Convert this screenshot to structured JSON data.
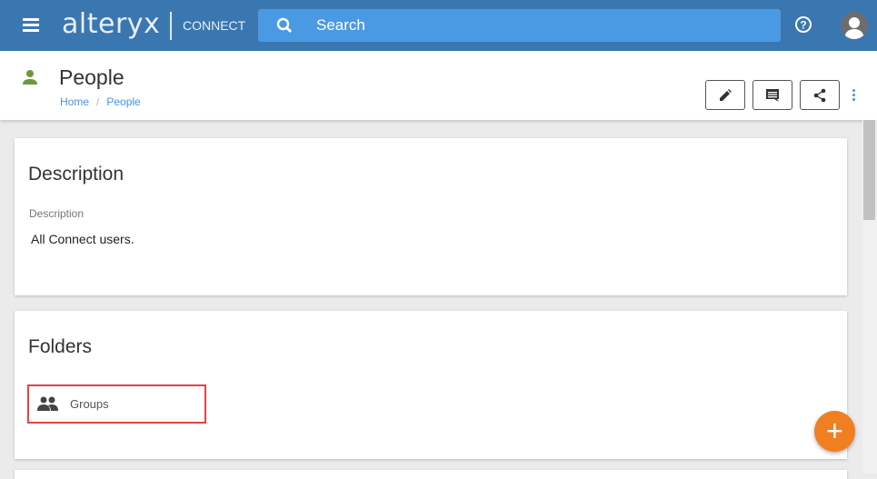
{
  "topbar": {
    "logo": "alteryx",
    "product": "CONNECT",
    "search_placeholder": "Search"
  },
  "header": {
    "title": "People",
    "breadcrumb": [
      {
        "label": "Home"
      },
      {
        "label": "People"
      }
    ]
  },
  "description_card": {
    "title": "Description",
    "field_label": "Description",
    "field_value": "All Connect users."
  },
  "folders_card": {
    "title": "Folders",
    "items": [
      {
        "label": "Groups",
        "icon": "group-icon"
      }
    ]
  },
  "colors": {
    "topbar": "#3a77b0",
    "search": "#4a9ae3",
    "accent": "#f07f22",
    "person_icon": "#6a9a3a",
    "highlight": "#e24444"
  }
}
